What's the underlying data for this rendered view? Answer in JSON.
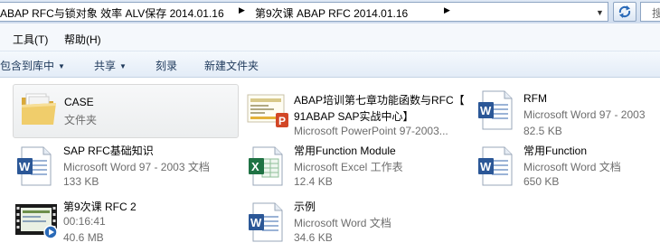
{
  "address_bar": {
    "crumbs": [
      "ABAP RFC与锁对象 效率 ALV保存 2014.01.16",
      "第9次课 ABAP RFC 2014.01.16"
    ],
    "search_placeholder": "搜"
  },
  "menubar": {
    "items": [
      "工具(T)",
      "帮助(H)"
    ]
  },
  "command_bar": {
    "items": [
      "包含到库中",
      "共享",
      "刻录",
      "新建文件夹"
    ]
  },
  "files": [
    {
      "name": "CASE",
      "line2": "文件夹",
      "line3": "",
      "icon": "folder-icon"
    },
    {
      "name": "ABAP培训第七章功能函数与RFC【",
      "line2": "91ABAP SAP实战中心】",
      "line3": "Microsoft PowerPoint 97-2003...",
      "icon": "powerpoint-icon"
    },
    {
      "name": "RFM",
      "line2": "Microsoft Word 97 - 2003",
      "line3": "82.5 KB",
      "icon": "word-icon"
    },
    {
      "name": "SAP RFC基础知识",
      "line2": "Microsoft Word 97 - 2003 文档",
      "line3": "133 KB",
      "icon": "word-icon"
    },
    {
      "name": "常用Function Module",
      "line2": "Microsoft Excel 工作表",
      "line3": "12.4 KB",
      "icon": "excel-icon"
    },
    {
      "name": "常用Function",
      "line2": "Microsoft Word 文档",
      "line3": "650 KB",
      "icon": "word-icon"
    },
    {
      "name": "第9次课 RFC 2",
      "line2": "00:16:41",
      "line3": "40.6 MB",
      "icon": "video-icon"
    },
    {
      "name": "示例",
      "line2": "Microsoft Word 文档",
      "line3": "34.6 KB",
      "icon": "word-icon"
    }
  ],
  "colors": {
    "word_blue": "#2b5797",
    "excel_green": "#1f7244",
    "ppt_orange": "#d24726",
    "folder_yellow": "#e8c15a"
  }
}
